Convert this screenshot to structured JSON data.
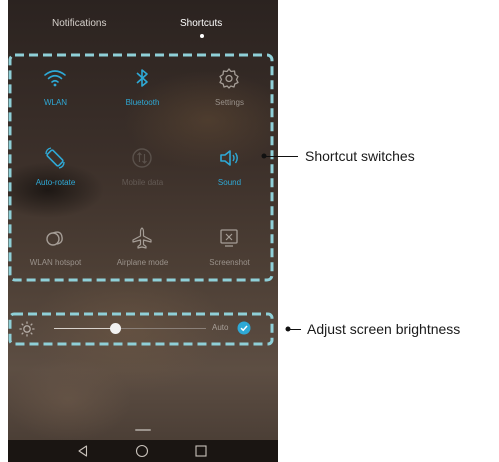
{
  "tabs": {
    "notifications": "Notifications",
    "shortcuts": "Shortcuts"
  },
  "shortcuts": [
    {
      "label": "WLAN",
      "icon": "wifi-icon",
      "state": "on"
    },
    {
      "label": "Bluetooth",
      "icon": "bluetooth-icon",
      "state": "on"
    },
    {
      "label": "Settings",
      "icon": "gear-icon",
      "state": "off"
    },
    {
      "label": "Auto-rotate",
      "icon": "auto-rotate-icon",
      "state": "on"
    },
    {
      "label": "Mobile data",
      "icon": "mobile-data-icon",
      "state": "disabled"
    },
    {
      "label": "Sound",
      "icon": "speaker-icon",
      "state": "on"
    },
    {
      "label": "WLAN hotspot",
      "icon": "hotspot-icon",
      "state": "off"
    },
    {
      "label": "Airplane mode",
      "icon": "airplane-icon",
      "state": "off"
    },
    {
      "label": "Screenshot",
      "icon": "screenshot-icon",
      "state": "off"
    }
  ],
  "brightness": {
    "level": 0.4,
    "auto_label": "Auto",
    "auto_enabled": true
  },
  "nav": {
    "back": "back-icon",
    "home": "home-icon",
    "recents": "recents-icon"
  },
  "callouts": {
    "shortcut_switches": "Shortcut switches",
    "adjust_brightness": "Adjust screen brightness"
  },
  "colors": {
    "accent": "#2ea9d6",
    "frame": "#8fd0d8",
    "callout_line": "#111111"
  }
}
